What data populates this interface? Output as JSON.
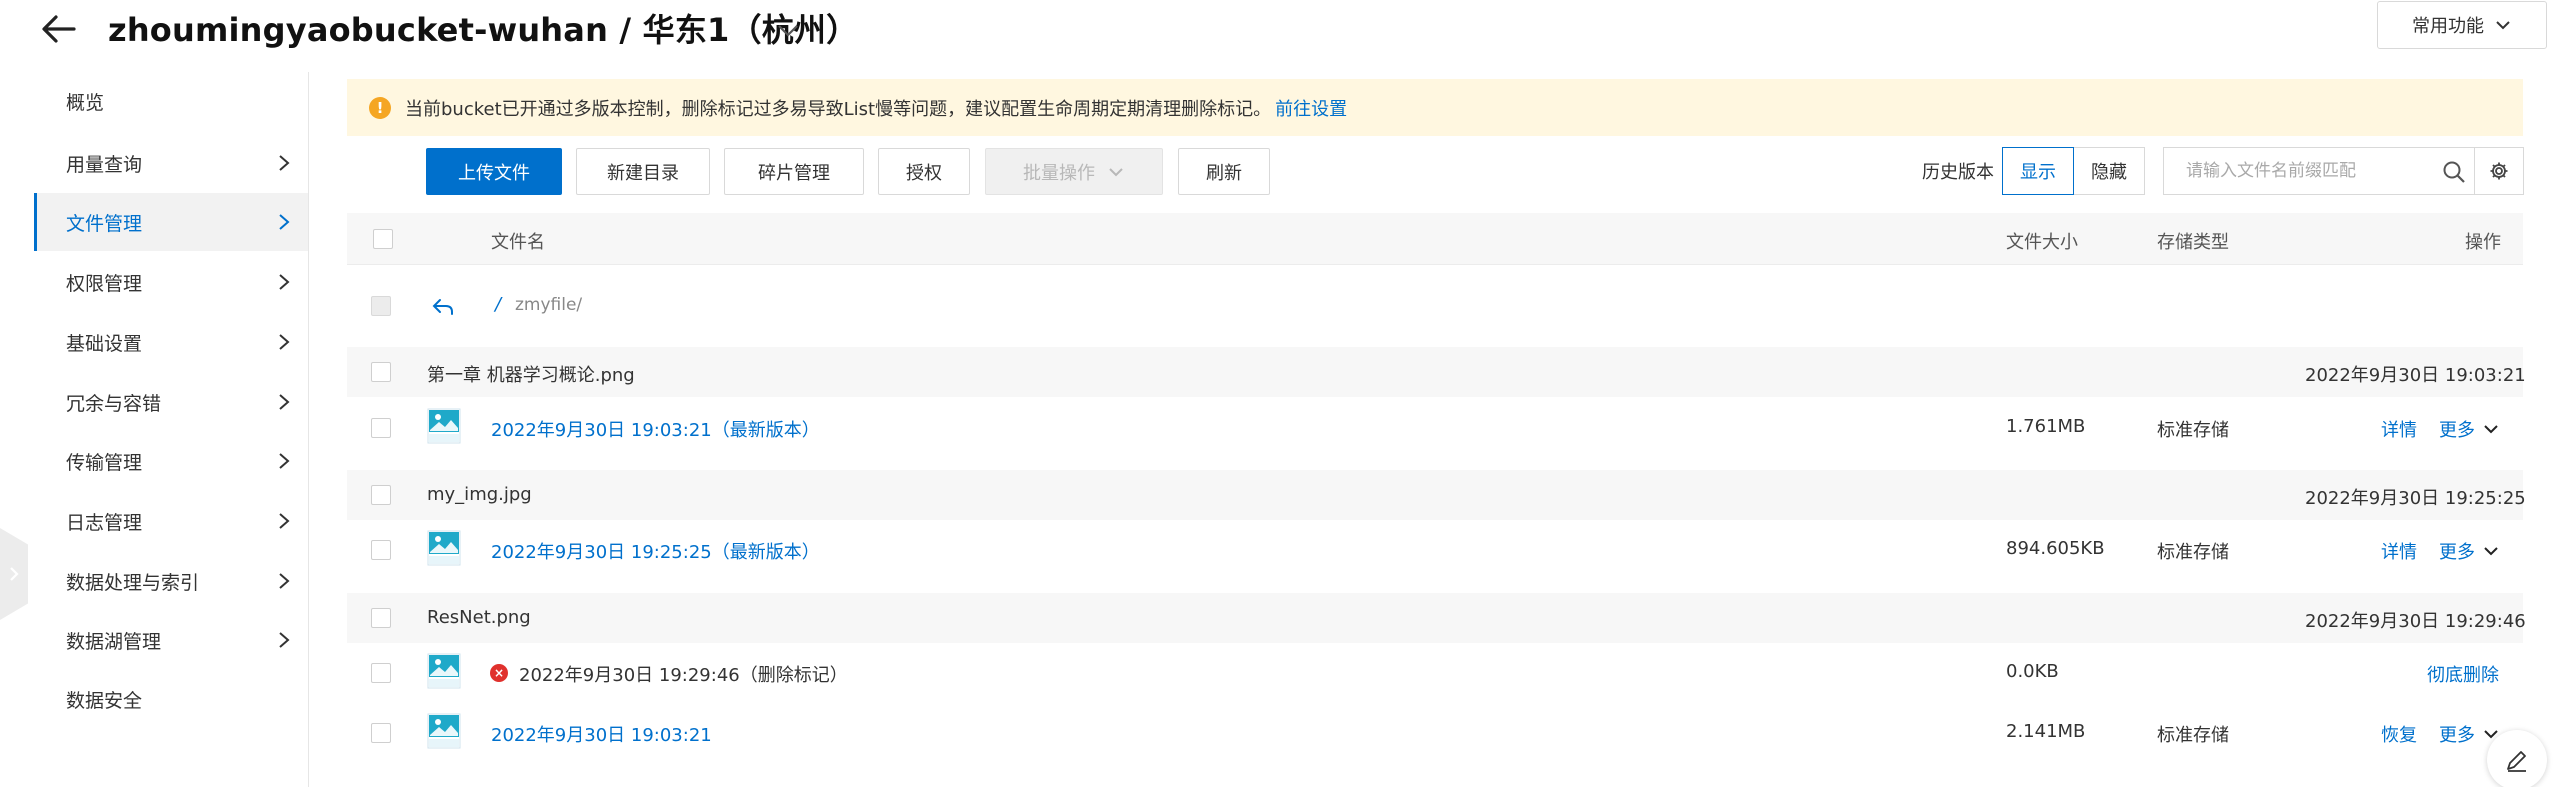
{
  "header": {
    "title": "zhoumingyaobucket-wuhan / 华东1（杭州）",
    "common_functions": "常用功能"
  },
  "sidebar": {
    "items": [
      {
        "label": "概览",
        "has_chevron": false
      },
      {
        "label": "用量查询",
        "has_chevron": true
      },
      {
        "label": "文件管理",
        "has_chevron": true,
        "active": true
      },
      {
        "label": "权限管理",
        "has_chevron": true
      },
      {
        "label": "基础设置",
        "has_chevron": true
      },
      {
        "label": "冗余与容错",
        "has_chevron": true
      },
      {
        "label": "传输管理",
        "has_chevron": true
      },
      {
        "label": "日志管理",
        "has_chevron": true
      },
      {
        "label": "数据处理与索引",
        "has_chevron": true
      },
      {
        "label": "数据湖管理",
        "has_chevron": true
      },
      {
        "label": "数据安全",
        "has_chevron": false
      }
    ]
  },
  "notice": {
    "text": "当前bucket已开通过多版本控制，删除标记过多易导致List慢等问题，建议配置生命周期定期清理删除标记。",
    "link": "前往设置"
  },
  "toolbar": {
    "upload": "上传文件",
    "new_dir": "新建目录",
    "fragments": "碎片管理",
    "authorize": "授权",
    "batch": "批量操作",
    "refresh": "刷新",
    "history_label": "历史版本",
    "show": "显示",
    "hide": "隐藏",
    "search_placeholder": "请输入文件名前缀匹配"
  },
  "table": {
    "columns": {
      "name": "文件名",
      "size": "文件大小",
      "storage": "存储类型",
      "actions": "操作"
    },
    "path": {
      "root": "/",
      "folder": "zmyfile/"
    },
    "groups": [
      {
        "name": "第一章 机器学习概论.png",
        "time": "2022年9月30日 19:03:21",
        "versions": [
          {
            "label": "2022年9月30日 19:03:21（最新版本）",
            "size": "1.761MB",
            "storage": "标准存储",
            "action1": "详情",
            "action2": "更多"
          }
        ]
      },
      {
        "name": "my_img.jpg",
        "time": "2022年9月30日 19:25:25",
        "versions": [
          {
            "label": "2022年9月30日 19:25:25（最新版本）",
            "size": "894.605KB",
            "storage": "标准存储",
            "action1": "详情",
            "action2": "更多"
          }
        ]
      },
      {
        "name": "ResNet.png",
        "time": "2022年9月30日 19:29:46",
        "versions": [
          {
            "label": "2022年9月30日 19:29:46（删除标记）",
            "size": "0.0KB",
            "storage": "",
            "action1": "彻底删除",
            "deleted": true
          },
          {
            "label": "2022年9月30日 19:03:21",
            "size": "2.141MB",
            "storage": "标准存储",
            "action1": "恢复",
            "action2": "更多"
          }
        ]
      }
    ]
  },
  "colors": {
    "accent": "#0070cc",
    "notice_bg": "#fff7e0",
    "warning": "#f5a623",
    "error": "#e0312d"
  }
}
